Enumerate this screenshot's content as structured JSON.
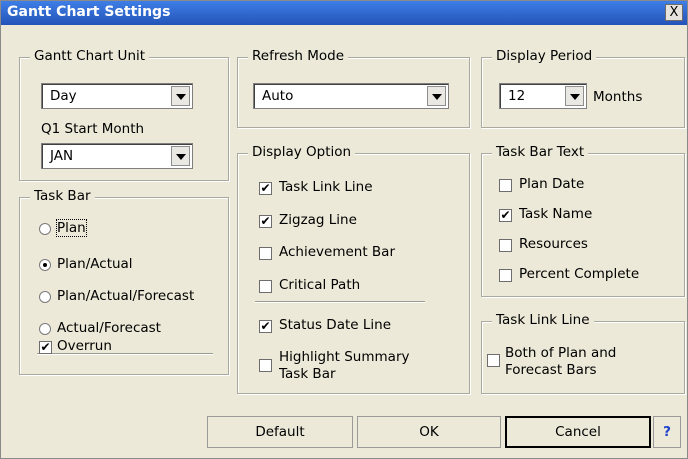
{
  "window": {
    "title": "Gantt Chart Settings",
    "close": "X"
  },
  "gantt_unit": {
    "legend": "Gantt Chart Unit",
    "unit_value": "Day",
    "q1_label": "Q1 Start Month",
    "q1_value": "JAN"
  },
  "refresh": {
    "legend": "Refresh Mode",
    "value": "Auto"
  },
  "display_period": {
    "legend": "Display Period",
    "value": "12",
    "unit": "Months"
  },
  "task_bar": {
    "legend": "Task Bar",
    "options": [
      "Plan",
      "Plan/Actual",
      "Plan/Actual/Forecast",
      "Actual/Forecast"
    ],
    "selected": "Plan/Actual",
    "overrun_label": "Overrun",
    "overrun_checked": true
  },
  "display_option": {
    "legend": "Display Option",
    "items": [
      {
        "label": "Task Link Line",
        "checked": true
      },
      {
        "label": "Zigzag Line",
        "checked": true
      },
      {
        "label": "Achievement Bar",
        "checked": false
      },
      {
        "label": "Critical Path",
        "checked": false
      },
      {
        "label": "Status Date Line",
        "checked": true
      },
      {
        "label": "Highlight Summary",
        "label2": "Task Bar",
        "checked": false
      }
    ]
  },
  "task_bar_text": {
    "legend": "Task Bar Text",
    "items": [
      {
        "label": "Plan Date",
        "checked": false
      },
      {
        "label": "Task Name",
        "checked": true
      },
      {
        "label": "Resources",
        "checked": false
      },
      {
        "label": "Percent Complete",
        "checked": false
      }
    ]
  },
  "task_link_line": {
    "legend": "Task Link Line",
    "label": "Both of Plan and",
    "label2": "Forecast Bars",
    "checked": false
  },
  "buttons": {
    "default": "Default",
    "ok": "OK",
    "cancel": "Cancel",
    "help": "?"
  },
  "check_mark": "✔"
}
